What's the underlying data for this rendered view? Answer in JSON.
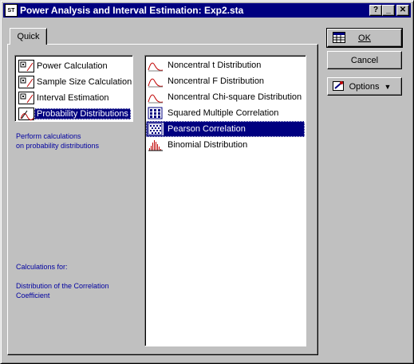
{
  "window": {
    "title": "Power Analysis and Interval Estimation: Exp2.sta",
    "app_icon_text": "ST",
    "help_button": "?",
    "minimize_button": "_",
    "close_button": "✕"
  },
  "tabs": [
    {
      "label": "Quick"
    }
  ],
  "categories": [
    {
      "label": "Power Calculation"
    },
    {
      "label": "Sample Size Calculation"
    },
    {
      "label": "Interval Estimation"
    },
    {
      "label": "Probability Distributions",
      "selected": true
    }
  ],
  "category_description": [
    "Perform calculations",
    "on probability distributions"
  ],
  "calc_for": {
    "heading": "Calculations for:",
    "lines": [
      "Distribution of the Correlation",
      "Coefficient"
    ]
  },
  "distributions": [
    {
      "label": "Noncentral t Distribution",
      "icon": "curve-icon"
    },
    {
      "label": "Noncentral F Distribution",
      "icon": "curve-icon"
    },
    {
      "label": "Noncentral Chi-square Distribution",
      "icon": "curve-icon"
    },
    {
      "label": "Squared Multiple Correlation",
      "icon": "grid-icon"
    },
    {
      "label": "Pearson Correlation",
      "icon": "grid-icon",
      "selected": true
    },
    {
      "label": "Binomial Distribution",
      "icon": "histogram-icon"
    }
  ],
  "buttons": {
    "ok": "OK",
    "cancel": "Cancel",
    "options": "Options",
    "options_arrow": "▼"
  },
  "colors": {
    "title_bar": "#000080",
    "selection": "#000080",
    "info_text": "#0000a0",
    "dialog_bg": "#c0c0c0"
  }
}
